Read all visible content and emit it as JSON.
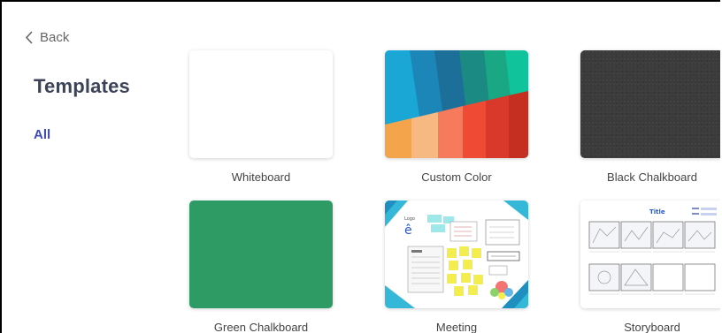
{
  "nav": {
    "back_label": "Back"
  },
  "sidebar": {
    "title": "Templates",
    "categories": [
      {
        "label": "All"
      }
    ]
  },
  "templates": [
    {
      "label": "Whiteboard"
    },
    {
      "label": "Custom Color"
    },
    {
      "label": "Black Chalkboard"
    },
    {
      "label": "Green Chalkboard"
    },
    {
      "label": "Meeting"
    },
    {
      "label": "Storyboard"
    }
  ],
  "storyboard_preview": {
    "title": "Title"
  },
  "colors": {
    "accent": "#3f4bb0",
    "black_chalkboard": "#3b3b3b",
    "green_chalkboard": "#2e9a64"
  }
}
